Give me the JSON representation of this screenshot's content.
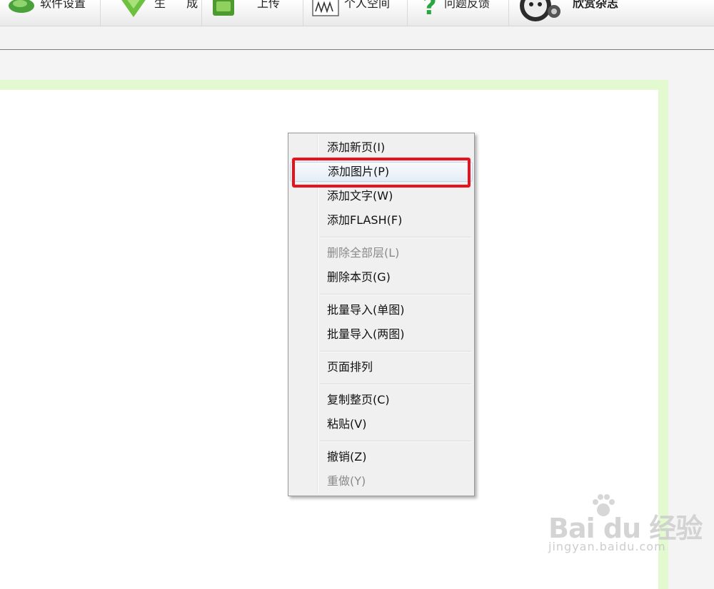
{
  "toolbar": {
    "items": [
      {
        "label": "软件设置",
        "icon": "settings-icon"
      },
      {
        "label": "生 成",
        "icon": "generate-icon"
      },
      {
        "label": "上传",
        "icon": "upload-icon"
      },
      {
        "label": "个人空间",
        "icon": "personal-space-icon"
      },
      {
        "label": "问题反馈",
        "icon": "help-icon"
      },
      {
        "label": "欣赏杂志",
        "icon": "avatar-icon"
      }
    ]
  },
  "context_menu": {
    "items": [
      {
        "label": "添加新页(I)",
        "enabled": true
      },
      {
        "label": "添加图片(P)",
        "enabled": true,
        "highlighted": true
      },
      {
        "label": "添加文字(W)",
        "enabled": true
      },
      {
        "label": "添加FLASH(F)",
        "enabled": true
      },
      {
        "label": "删除全部层(L)",
        "enabled": false
      },
      {
        "label": "删除本页(G)",
        "enabled": true
      },
      {
        "label": "批量导入(单图)",
        "enabled": true
      },
      {
        "label": "批量导入(两图)",
        "enabled": true
      },
      {
        "label": "页面排列",
        "enabled": true
      },
      {
        "label": "复制整页(C)",
        "enabled": true
      },
      {
        "label": "粘贴(V)",
        "enabled": true
      },
      {
        "label": "撤销(Z)",
        "enabled": true
      },
      {
        "label": "重做(Y)",
        "enabled": false
      }
    ]
  },
  "colors": {
    "highlight_box": "#e8121c",
    "canvas_border": "#e3f9cf",
    "menu_background": "#f0f0f0"
  },
  "watermark": {
    "brand": "Bai du 经验",
    "url": "jingyan.baidu.com"
  }
}
